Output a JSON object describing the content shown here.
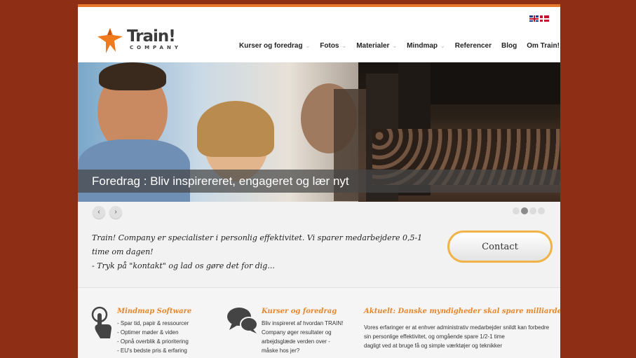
{
  "header": {
    "logo": {
      "title": "Train!",
      "subtitle": "COMPANY"
    },
    "languages": [
      "English",
      "Dansk"
    ],
    "nav": [
      {
        "label": "Kurser og foredrag",
        "dropdown": true
      },
      {
        "label": "Fotos",
        "dropdown": true
      },
      {
        "label": "Materialer",
        "dropdown": true
      },
      {
        "label": "Mindmap",
        "dropdown": true
      },
      {
        "label": "Referencer",
        "dropdown": false
      },
      {
        "label": "Blog",
        "dropdown": false
      },
      {
        "label": "Om Train!",
        "dropdown": true
      }
    ]
  },
  "slider": {
    "caption": "Foredrag : Bliv inspirereret, engageret og lær nyt",
    "prev_icon": "‹",
    "next_icon": "›",
    "active_slide": 2,
    "slide_count": 4
  },
  "intro": {
    "line1": "Train! Company er specialister i personlig effektivitet. Vi sparer medarbejdere 0,5-1 time om dagen!",
    "line2": "- Tryk på \"kontakt\" og lad os gøre det for dig...",
    "contact_label": "Contact"
  },
  "features": [
    {
      "title": "Mindmap Software",
      "icon": "touch-hand-icon",
      "lines": [
        "- Spar tid, papir & ressourcer",
        "- Optimer møder & viden",
        "- Opnå overblik & prioritering",
        "- EU's bedste pris & erfaring"
      ]
    },
    {
      "title": "Kurser og foredrag",
      "icon": "speech-bubbles-icon",
      "lines": [
        "Bliv inspireret af hvordan TRAIN!",
        "Company øger resultater og",
        "arbejdsglæde verden over -",
        "måske hos jer?"
      ]
    },
    {
      "title": "Aktuelt: Danske myndigheder skal spare milliarder",
      "lines": [
        "Vores erfaringer er at enhver administrativ medarbejder snildt kan forbedre",
        "sin personlige effektivitet, og omgående spare 1/2-1 time",
        "dagligt ved at bruge få og simple værktøjer og teknikker"
      ]
    }
  ],
  "colors": {
    "background": "#8e2e14",
    "accent": "#e8862a",
    "button_border": "#f0b347"
  }
}
